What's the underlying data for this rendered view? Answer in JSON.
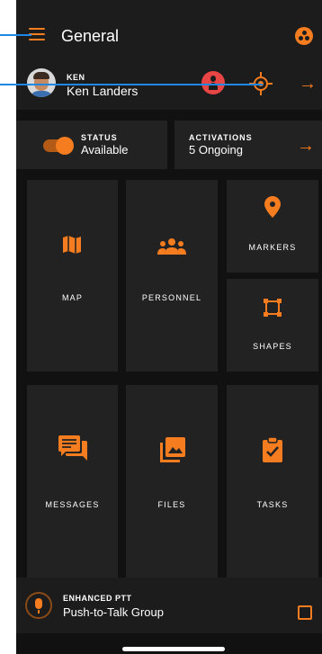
{
  "header": {
    "title": "General",
    "menu_icon": "hamburger-menu-icon",
    "right_icon": "team-dots-icon"
  },
  "user": {
    "short_name": "KEN",
    "full_name": "Ken Landers",
    "alert_icon": "person-alert-icon",
    "locate_icon": "crosshair-locate-icon",
    "arrow": "→"
  },
  "status": {
    "label": "STATUS",
    "value": "Available"
  },
  "activations": {
    "label": "ACTIVATIONS",
    "value": "5 Ongoing",
    "arrow": "→"
  },
  "tiles": {
    "map": "MAP",
    "personnel": "PERSONNEL",
    "markers": "MARKERS",
    "shapes": "SHAPES",
    "messages": "MESSAGES",
    "files": "FILES",
    "tasks": "TASKS"
  },
  "ptt": {
    "title": "ENHANCED PTT",
    "group": "Push-to-Talk Group",
    "icon": "microphone-icon",
    "open_icon": "open-external-icon"
  },
  "colors": {
    "accent": "#f57c1f",
    "alert": "#e84545",
    "background": "#111111",
    "tile": "#222222",
    "callout": "#1e88e5"
  }
}
